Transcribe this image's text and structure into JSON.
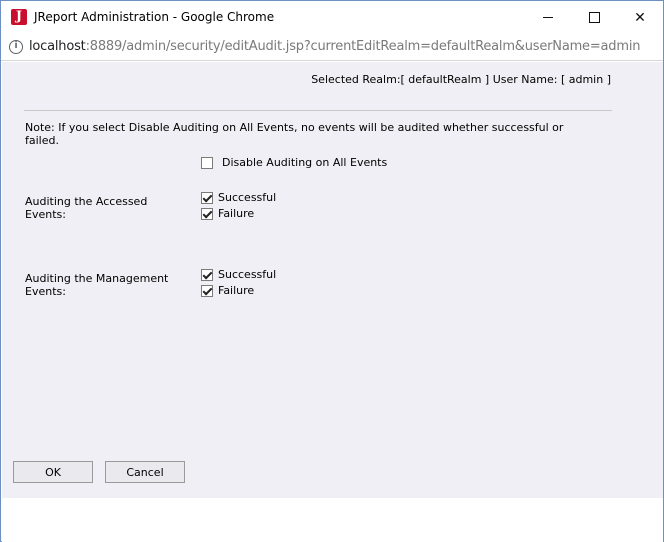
{
  "window": {
    "title": "JReport Administration - Google Chrome",
    "app_icon_letter": "J",
    "controls": {
      "minimize": "",
      "maximize": "",
      "close": "✕"
    }
  },
  "address_bar": {
    "host": "localhost",
    "rest": ":8889/admin/security/editAudit.jsp?currentEditRealm=defaultRealm&userName=admin",
    "info_glyph": "i"
  },
  "page": {
    "realm_line": "Selected Realm:[ defaultRealm ]  User Name: [ admin ]",
    "note": "Note: If you select Disable Auditing on All Events, no events will be audited whether successful or failed.",
    "disable_all": {
      "label": "Disable Auditing on All Events",
      "checked": false
    },
    "accessed": {
      "label": "Auditing the Accessed Events:",
      "successful": {
        "label": "Successful",
        "checked": true
      },
      "failure": {
        "label": "Failure",
        "checked": true
      }
    },
    "management": {
      "label": "Auditing the Management Events:",
      "successful": {
        "label": "Successful",
        "checked": true
      },
      "failure": {
        "label": "Failure",
        "checked": true
      }
    },
    "buttons": {
      "ok": "OK",
      "cancel": "Cancel"
    }
  }
}
